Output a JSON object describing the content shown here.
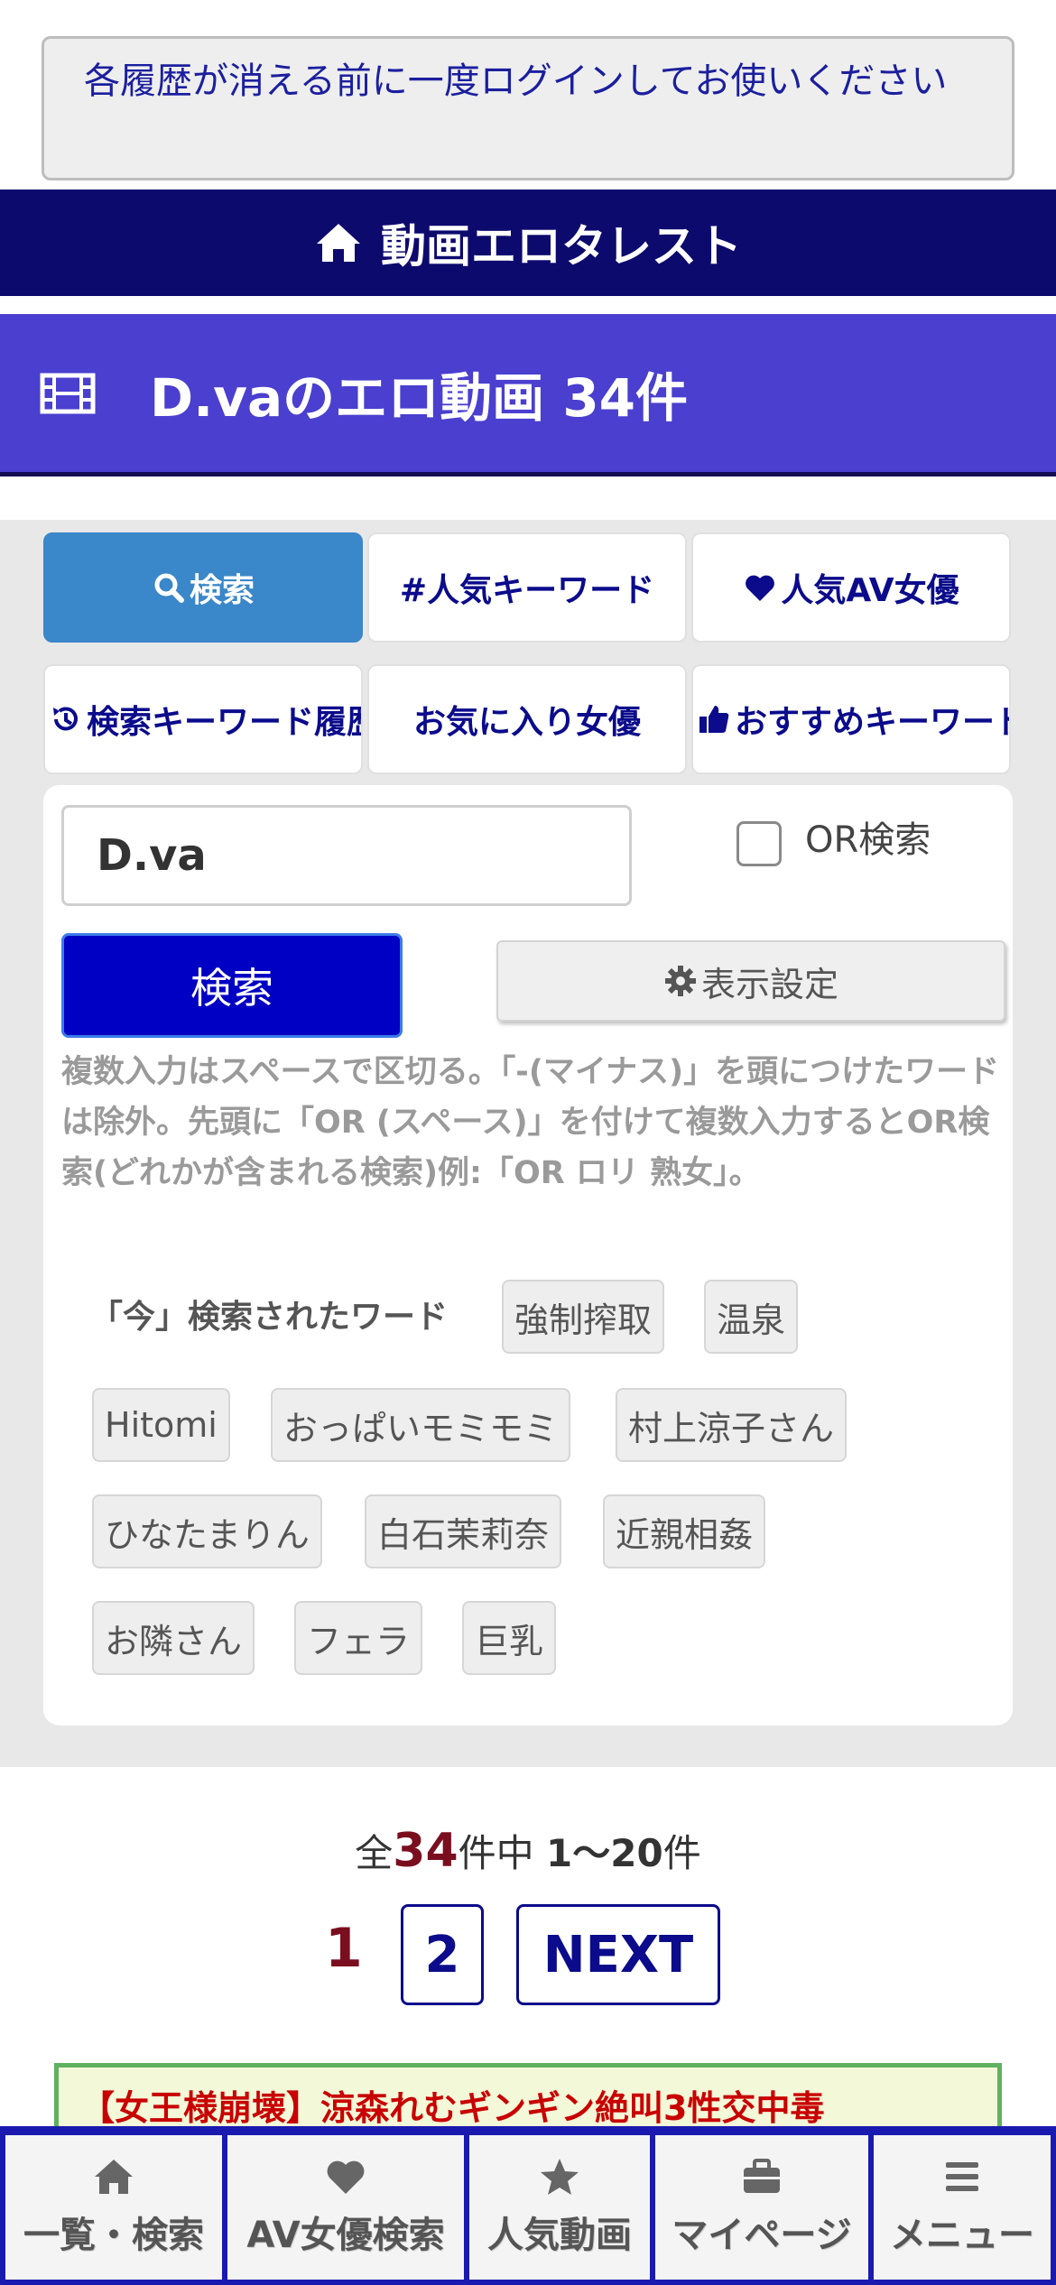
{
  "notice": {
    "text": "各履歴が消える前に一度ログインしてお使いください"
  },
  "header": {
    "title": "動画エロタレスト"
  },
  "page_title": {
    "text": "D.vaのエロ動画 34件"
  },
  "tabs": [
    {
      "label": "検索",
      "icon": "search-icon"
    },
    {
      "label": "#人気キーワード"
    },
    {
      "label": "人気AV女優",
      "icon": "heart-icon"
    },
    {
      "label": "検索キーワード履歴",
      "icon": "history-icon"
    },
    {
      "label": "お気に入り女優"
    },
    {
      "label": "おすすめキーワード",
      "icon": "thumbs-up-icon"
    }
  ],
  "search": {
    "value": "D.va",
    "or_label": "OR検索",
    "button_label": "検索",
    "display_settings_label": "表示設定",
    "help": "複数入力はスペースで区切る。「-(マイナス)」を頭につけたワードは除外。先頭に「OR (スペース)」を付けて複数入力するとOR検索(どれかが含まれる検索)例:「OR ロリ 熟女」。"
  },
  "recent": {
    "label": "「今」検索されたワード",
    "words": [
      "強制搾取",
      "温泉",
      "Hitomi",
      "おっぱいモミモミ",
      "村上涼子さん",
      "ひなたまりん",
      "白石茉莉奈",
      "近親相姦",
      "お隣さん",
      "フェラ",
      "巨乳"
    ]
  },
  "results": {
    "prefix": "全",
    "total": "34",
    "middle": "件中 ",
    "range": "1〜20",
    "suffix": "件"
  },
  "pagination": {
    "current": "1",
    "page2": "2",
    "next": "NEXT"
  },
  "promo": {
    "text": "【女王様崩壊】涼森れむギンギン絶叫3性交中毒"
  },
  "bottom_nav": [
    {
      "label": "一覧・検索",
      "icon": "home-icon"
    },
    {
      "label": "AV女優検索",
      "icon": "heart-icon"
    },
    {
      "label": "人気動画",
      "icon": "star-icon"
    },
    {
      "label": "マイページ",
      "icon": "briefcase-icon"
    },
    {
      "label": "メニュー",
      "icon": "menu-icon"
    }
  ]
}
